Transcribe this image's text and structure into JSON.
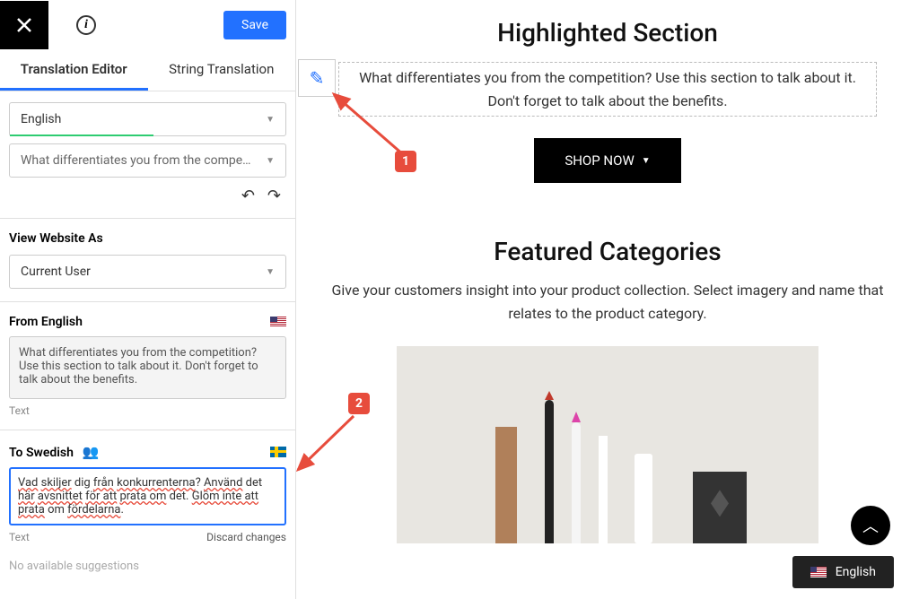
{
  "toolbar": {
    "save_label": "Save"
  },
  "tabs": {
    "editor": "Translation Editor",
    "string": "String Translation"
  },
  "language_select": "English",
  "string_select": "What differentiates you from the competition? Use...",
  "view_as": {
    "title": "View Website As",
    "value": "Current User"
  },
  "from": {
    "title": "From English",
    "text": "What differentiates you from the competition? Use this section to talk about it. Don't forget to talk about the benefits.",
    "meta": "Text"
  },
  "to": {
    "title": "To Swedish",
    "text_parts": [
      {
        "t": "Vad",
        "s": true
      },
      {
        "t": " "
      },
      {
        "t": "skiljer",
        "s": true
      },
      {
        "t": " dig "
      },
      {
        "t": "från",
        "s": true
      },
      {
        "t": " "
      },
      {
        "t": "konkurrenterna",
        "s": true
      },
      {
        "t": "? "
      },
      {
        "t": "Använd",
        "s": true
      },
      {
        "t": " det "
      },
      {
        "t": "här",
        "s": true
      },
      {
        "t": " "
      },
      {
        "t": "avsnittet",
        "s": true
      },
      {
        "t": " "
      },
      {
        "t": "för att",
        "s": true
      },
      {
        "t": " "
      },
      {
        "t": "prata om",
        "s": true
      },
      {
        "t": " det. "
      },
      {
        "t": "Glöm inte att",
        "s": true
      },
      {
        "t": " "
      },
      {
        "t": "prata",
        "s": true
      },
      {
        "t": " om "
      },
      {
        "t": "fördelarna",
        "s": true
      },
      {
        "t": "."
      }
    ],
    "meta": "Text",
    "discard": "Discard changes",
    "no_suggestions": "No available suggestions"
  },
  "annotations": {
    "marker1": "1",
    "marker2": "2"
  },
  "preview": {
    "hero_title": "Highlighted Section",
    "hero_desc": "What differentiates you from the competition? Use this section to talk about it. Don't forget to talk about the benefits.",
    "shop_btn": "SHOP NOW",
    "featured_title": "Featured Categories",
    "featured_desc": "Give your customers insight into your product collection. Select imagery and name that relates to the product category."
  },
  "lang_switcher": "English"
}
